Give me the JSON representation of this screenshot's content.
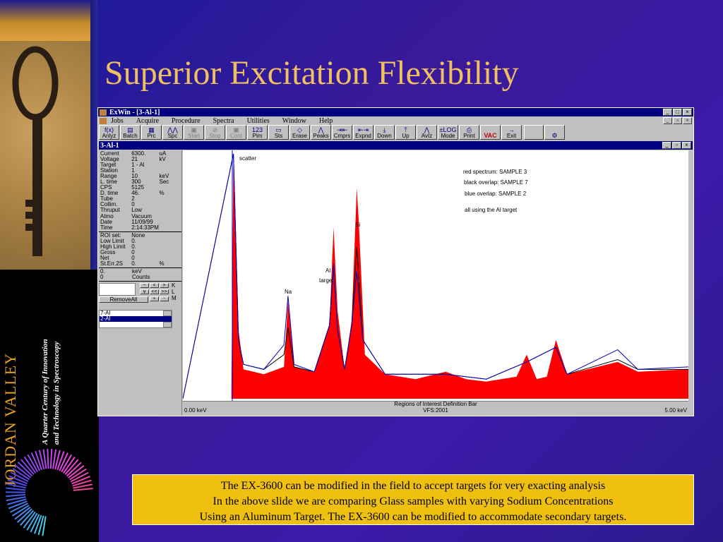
{
  "slide": {
    "title": "Superior Excitation Flexibility",
    "brand": "JORDAN  VALLEY",
    "tagline_1": "A Quarter Century of Innovation",
    "tagline_2": "and Technology in Spectroscopy"
  },
  "app": {
    "title": "ExWin - [3-Al-1]",
    "menu": [
      "Jobs",
      "Acquire",
      "Procedure",
      "Spectra",
      "Utilities",
      "Window",
      "Help"
    ],
    "toolbar": [
      {
        "label": "Anlyz",
        "icon": "f(x)",
        "dim": false
      },
      {
        "label": "Batch",
        "icon": "▤",
        "dim": false
      },
      {
        "label": "Prc",
        "icon": "▦",
        "dim": false
      },
      {
        "label": "Spc",
        "icon": "⋀⋀",
        "dim": false
      },
      {
        "label": "Start",
        "icon": "▣",
        "dim": true
      },
      {
        "label": "Stop",
        "icon": "⊘",
        "dim": true
      },
      {
        "label": "Cont",
        "icon": "▣",
        "dim": true
      },
      {
        "label": "Pim",
        "icon": "123",
        "dim": false
      },
      {
        "label": "Sts",
        "icon": "▭",
        "dim": false
      },
      {
        "label": "Erase",
        "icon": "◇",
        "dim": false
      },
      {
        "label": "Peaks",
        "icon": "⋀",
        "dim": false
      },
      {
        "label": "Cmprs",
        "icon": "⇥⇤",
        "dim": false
      },
      {
        "label": "Expnd",
        "icon": "⇤⇥",
        "dim": false
      },
      {
        "label": "Down",
        "icon": "⤓",
        "dim": false
      },
      {
        "label": "Up",
        "icon": "⤒",
        "dim": false
      },
      {
        "label": "AvIz",
        "icon": "⋀",
        "dim": false
      },
      {
        "label": "Mode",
        "icon": "±LOG",
        "dim": false
      },
      {
        "label": "Print",
        "icon": "⎙",
        "dim": false
      },
      {
        "label": "",
        "icon": "VAC",
        "dim": false
      },
      {
        "label": "Exit",
        "icon": "→",
        "dim": false
      }
    ],
    "child_title": "3-Al-1",
    "acquisition": [
      [
        "Current",
        "6300.",
        "uA"
      ],
      [
        "Voltage",
        "21",
        "kV"
      ],
      [
        "Target",
        "1 - Al",
        ""
      ],
      [
        "Station",
        "1",
        ""
      ],
      [
        "Range",
        "10",
        "keV"
      ],
      [
        "L. time",
        "300",
        "Sec"
      ],
      [
        "CPS",
        "5125",
        ""
      ],
      [
        "D. time",
        "46.",
        "%"
      ],
      [
        "Tube",
        "2",
        ""
      ],
      [
        "Collim.",
        "0",
        ""
      ],
      [
        "Thruput",
        "Low",
        ""
      ],
      [
        "Atmo",
        "Vacuum",
        ""
      ],
      [
        "Date",
        "11/09/99",
        ""
      ],
      [
        "Time",
        "2:14:33PM",
        ""
      ]
    ],
    "roi": [
      [
        "ROI set:",
        "None",
        ""
      ],
      [
        "Low Limit",
        "0.",
        ""
      ],
      [
        "High Limit",
        "0.",
        ""
      ],
      [
        "Gross",
        "0",
        ""
      ],
      [
        "Net",
        "0",
        ""
      ],
      [
        "St.Err.2S",
        "0.",
        "%"
      ]
    ],
    "cursor": [
      [
        "0.",
        "keV"
      ],
      [
        "0",
        "Counts"
      ]
    ],
    "remove_all": "RemoveAll",
    "side_letters": [
      "K",
      "L",
      "M"
    ],
    "spectra_list": [
      "7-Al",
      "2-Al"
    ],
    "roi_bar": "Regions of Interest Definition Bar",
    "axis_left": "0.00 keV",
    "axis_center": "VFS:2001",
    "axis_right": "5.00 keV"
  },
  "annotations": {
    "scatter": "scatter",
    "na": "Na",
    "al": "Al",
    "target": "target",
    "si": "Si",
    "legend_red": "red spectrum: SAMPLE 3",
    "legend_black": "black overlap: SAMPLE 7",
    "legend_blue": "blue overlap: SAMPLE 2",
    "legend_note": "all using the Al target"
  },
  "colors": {
    "red_spectrum": "#ff0000",
    "black_overlay": "#000000",
    "blue_overlay": "#0000c0"
  },
  "chart_data": {
    "type": "area",
    "x_unit": "keV",
    "xlim": [
      0.0,
      5.0
    ],
    "series": [
      {
        "name": "red spectrum: SAMPLE 3",
        "points": [
          [
            0.0,
            0
          ],
          [
            0.48,
            0
          ],
          [
            0.5,
            100
          ],
          [
            0.55,
            28
          ],
          [
            0.6,
            12
          ],
          [
            0.8,
            10
          ],
          [
            1.0,
            13
          ],
          [
            1.04,
            40
          ],
          [
            1.1,
            13
          ],
          [
            1.3,
            11
          ],
          [
            1.45,
            30
          ],
          [
            1.49,
            70
          ],
          [
            1.53,
            36
          ],
          [
            1.6,
            12
          ],
          [
            1.67,
            32
          ],
          [
            1.72,
            86
          ],
          [
            1.74,
            72
          ],
          [
            1.8,
            18
          ],
          [
            2.0,
            10
          ],
          [
            2.3,
            8
          ],
          [
            2.6,
            11
          ],
          [
            2.8,
            8
          ],
          [
            3.0,
            7
          ],
          [
            3.3,
            9
          ],
          [
            3.4,
            18
          ],
          [
            3.5,
            8
          ],
          [
            3.6,
            9
          ],
          [
            3.69,
            24
          ],
          [
            3.8,
            10
          ],
          [
            4.0,
            12
          ],
          [
            4.3,
            15
          ],
          [
            4.5,
            11
          ],
          [
            5.0,
            12
          ]
        ]
      },
      {
        "name": "black overlap: SAMPLE 7",
        "points": [
          [
            0.0,
            0
          ],
          [
            0.5,
            100
          ],
          [
            0.55,
            24
          ],
          [
            0.6,
            14
          ],
          [
            0.8,
            12
          ],
          [
            1.0,
            18
          ],
          [
            1.04,
            29
          ],
          [
            1.1,
            13
          ],
          [
            1.3,
            11
          ],
          [
            1.45,
            30
          ],
          [
            1.49,
            54
          ],
          [
            1.53,
            28
          ],
          [
            1.6,
            12
          ],
          [
            1.67,
            30
          ],
          [
            1.72,
            62
          ],
          [
            1.78,
            24
          ],
          [
            2.0,
            10
          ],
          [
            2.6,
            10
          ],
          [
            3.0,
            8
          ],
          [
            3.4,
            15
          ],
          [
            3.69,
            21
          ],
          [
            3.8,
            10
          ],
          [
            4.3,
            16
          ],
          [
            4.5,
            12
          ],
          [
            5.0,
            12
          ]
        ]
      },
      {
        "name": "blue overlap: SAMPLE 2",
        "points": [
          [
            0.0,
            0
          ],
          [
            0.5,
            100
          ],
          [
            0.55,
            24
          ],
          [
            0.6,
            14
          ],
          [
            0.8,
            12
          ],
          [
            1.0,
            22
          ],
          [
            1.04,
            42
          ],
          [
            1.1,
            14
          ],
          [
            1.3,
            11
          ],
          [
            1.45,
            30
          ],
          [
            1.49,
            55
          ],
          [
            1.53,
            28
          ],
          [
            1.6,
            12
          ],
          [
            1.67,
            30
          ],
          [
            1.72,
            52
          ],
          [
            1.78,
            24
          ],
          [
            2.0,
            10
          ],
          [
            2.6,
            10
          ],
          [
            3.0,
            8
          ],
          [
            3.4,
            15
          ],
          [
            3.69,
            21
          ],
          [
            3.8,
            10
          ],
          [
            4.3,
            20
          ],
          [
            4.5,
            12
          ],
          [
            5.0,
            13
          ]
        ]
      }
    ]
  },
  "caption": [
    "The EX-3600 can be modified in the field to accept targets for very exacting analysis",
    "In the above slide we are comparing Glass samples with varying Sodium Concentrations",
    "Using an Aluminum Target. The EX-3600 can be modified to accommodate secondary targets."
  ]
}
